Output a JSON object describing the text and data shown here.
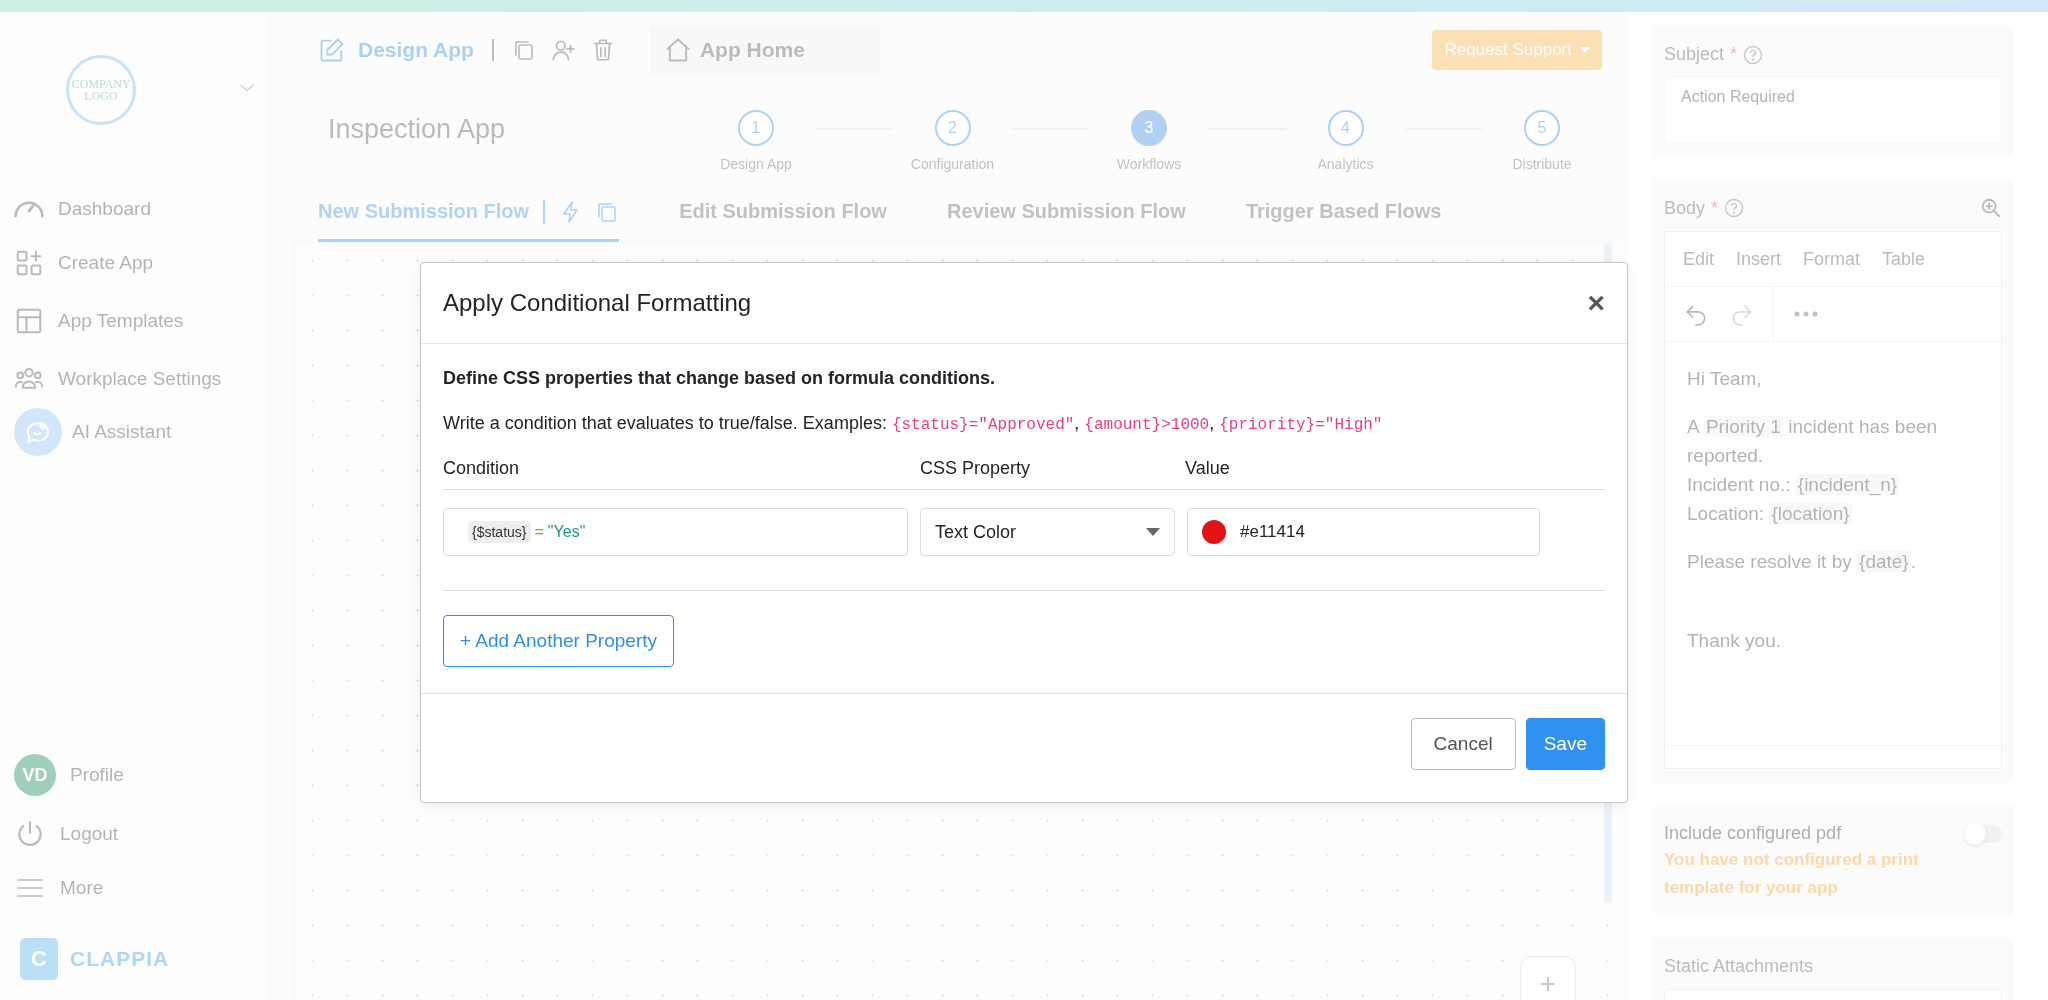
{
  "sidebar": {
    "logo_text": "COMPANY LOGO",
    "items": [
      {
        "label": "Dashboard",
        "kind": "gauge"
      },
      {
        "label": "Create App",
        "kind": "grid-plus"
      },
      {
        "label": "App Templates",
        "kind": "layout"
      },
      {
        "label": "Workplace Settings",
        "kind": "people"
      }
    ],
    "assistant": {
      "label": "AI Assistant"
    },
    "bottom_items": [
      {
        "label": "Profile",
        "kind": "avatar",
        "initials": "VD"
      },
      {
        "label": "Logout",
        "kind": "power"
      },
      {
        "label": "More",
        "kind": "menu"
      }
    ],
    "brand": {
      "mark": "C",
      "name": "CLAPPIA"
    }
  },
  "header": {
    "design_app": "Design App",
    "app_home": "App Home",
    "request_support": "Request Support"
  },
  "app_title": "Inspection App",
  "steps": [
    {
      "number": "1",
      "label": "Design App",
      "selected": false
    },
    {
      "number": "2",
      "label": "Configuration",
      "selected": false
    },
    {
      "number": "3",
      "label": "Workflows",
      "selected": true
    },
    {
      "number": "4",
      "label": "Analytics",
      "selected": false
    },
    {
      "number": "5",
      "label": "Distribute",
      "selected": false
    }
  ],
  "flow_tabs": [
    {
      "label": "New Submission Flow",
      "selected": true
    },
    {
      "label": "Edit Submission Flow",
      "selected": false
    },
    {
      "label": "Review Submission Flow",
      "selected": false
    },
    {
      "label": "Trigger Based Flows",
      "selected": false
    }
  ],
  "canvas": {
    "add_button": "+"
  },
  "modal": {
    "title": "Apply Conditional Formatting",
    "close": "×",
    "intro": "Define CSS properties that change based on formula conditions.",
    "hint": [
      {
        "kind": "text",
        "text": "Write a condition that evaluates to true/false. Examples: "
      },
      {
        "kind": "code",
        "text": "{status}=\"Approved\""
      },
      {
        "kind": "text",
        "text": ", "
      },
      {
        "kind": "code",
        "text": "{amount}>1000"
      },
      {
        "kind": "text",
        "text": ", "
      },
      {
        "kind": "code",
        "text": "{priority}=\"High\""
      }
    ],
    "columns": [
      "Condition",
      "CSS Property",
      "Value"
    ],
    "rows": [
      {
        "token": "{$status}",
        "operator": "=",
        "literal": "\"Yes\"",
        "property": "Text Color",
        "value": "#e11414",
        "color": "#e11414"
      }
    ],
    "add_button": "+ Add Another Property",
    "cancel": "Cancel",
    "save": "Save"
  },
  "right_panel": {
    "subject": {
      "label": "Subject",
      "required": "*",
      "value": "Action Required"
    },
    "body": {
      "label": "Body",
      "required": "*",
      "menu": [
        "Edit",
        "Insert",
        "Format",
        "Table"
      ],
      "paragraphs": [
        {
          "lines": [
            [
              {
                "text": "Hi Team,",
                "token": false
              }
            ]
          ]
        },
        {
          "lines": [
            [
              {
                "text": "A ",
                "token": false
              },
              {
                "text": "Priority 1",
                "token": true
              },
              {
                "text": " incident has been reported.",
                "token": false
              }
            ],
            [
              {
                "text": "Incident no.: ",
                "token": false
              },
              {
                "text": "{incident_n}",
                "token": true
              }
            ],
            [
              {
                "text": "Location: ",
                "token": false
              },
              {
                "text": "{location}",
                "token": true
              }
            ]
          ]
        },
        {
          "lines": [
            [
              {
                "text": "Please resolve it by ",
                "token": false
              },
              {
                "text": "{date}",
                "token": true
              },
              {
                "text": ".",
                "token": false
              }
            ]
          ]
        },
        {
          "lines": [
            [
              {
                "text": "Thank you.",
                "token": false
              }
            ]
          ]
        }
      ]
    },
    "include_pdf": {
      "label": "Include configured pdf",
      "on": false,
      "warning": "You have not configured a print template for your app"
    },
    "static_attachments": {
      "label": "Static Attachments"
    }
  }
}
